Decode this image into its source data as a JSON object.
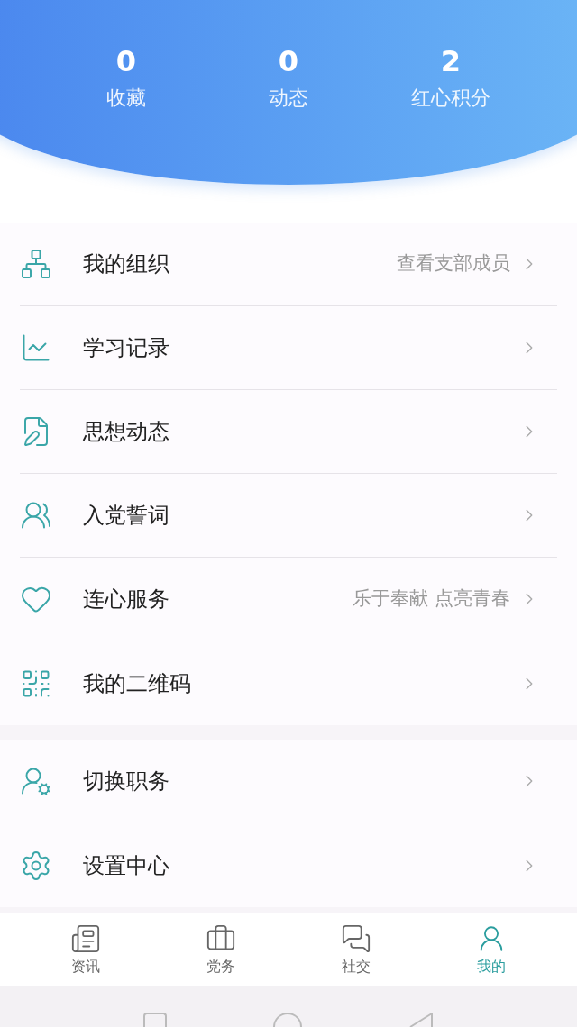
{
  "stats": [
    {
      "value": "0",
      "label": "收藏"
    },
    {
      "value": "0",
      "label": "动态"
    },
    {
      "value": "2",
      "label": "红心积分"
    }
  ],
  "menu_groups": [
    [
      {
        "label": "我的组织",
        "detail": "查看支部成员"
      },
      {
        "label": "学习记录"
      },
      {
        "label": "思想动态"
      },
      {
        "label": "入党誓词"
      },
      {
        "label": "连心服务",
        "detail": "乐于奉献 点亮青春"
      },
      {
        "label": "我的二维码"
      }
    ],
    [
      {
        "label": "切换职务"
      },
      {
        "label": "设置中心"
      }
    ]
  ],
  "tabs": [
    {
      "label": "资讯",
      "selected": false
    },
    {
      "label": "党务",
      "selected": false
    },
    {
      "label": "社交",
      "selected": false
    },
    {
      "label": "我的",
      "selected": true
    }
  ]
}
